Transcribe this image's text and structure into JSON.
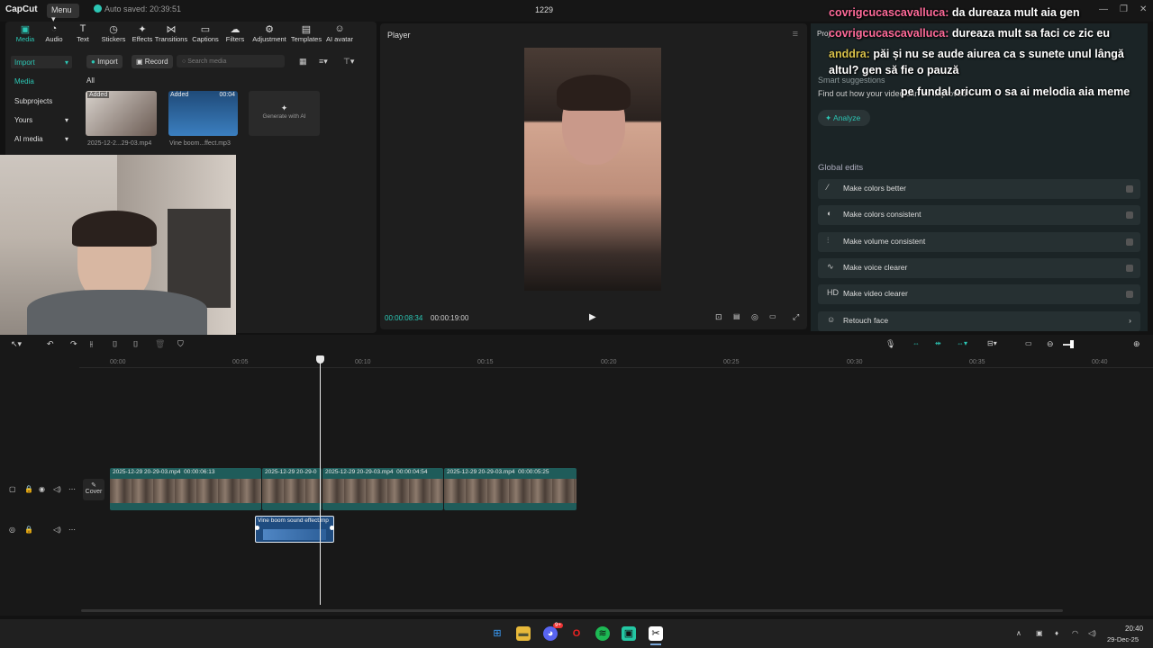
{
  "titlebar": {
    "logo": "CapCut",
    "menu": "Menu",
    "autosave": "Auto saved: 20:39:51",
    "project": "1229"
  },
  "toolbar": {
    "tools": [
      "Media",
      "Audio",
      "Text",
      "Stickers",
      "Effects",
      "Transitions",
      "Captions",
      "Filters",
      "Adjustment",
      "Templates",
      "AI avatar"
    ]
  },
  "sidenav": {
    "import": "Import",
    "media": "Media",
    "subprojects": "Subprojects",
    "yours": "Yours",
    "ai_media": "AI media"
  },
  "media": {
    "import_btn": "Import",
    "record_btn": "Record",
    "search_placeholder": "Search media",
    "filter_all": "All",
    "items": [
      {
        "badge": "Added",
        "name": "2025-12-2...29-03.mp4"
      },
      {
        "badge": "Added",
        "duration": "00:04",
        "name": "Vine boom...ffect.mp3"
      }
    ],
    "generate_ai": "Generate with AI"
  },
  "player": {
    "title": "Player",
    "current_time": "00:00:08:34",
    "total_time": "00:00:19:00"
  },
  "right_panel": {
    "tab_a": "Proj",
    "tab_b": "AI",
    "smart_suggestions": "Smart suggestions",
    "find_out": "Find out how your video can be improved",
    "analyze": "Analyze",
    "global_edits": "Global edits",
    "items": [
      "Make colors better",
      "Make colors consistent",
      "Make volume consistent",
      "Make voice clearer",
      "Make video clearer",
      "Retouch face"
    ]
  },
  "chat": [
    {
      "user": "covrigcucascavalluca:",
      "msg": " da dureaza mult aia gen"
    },
    {
      "user": "covrigcucascavalluca:",
      "msg": " dureaza mult sa faci ce zic eu"
    },
    {
      "user": "anddra:",
      "msg": " păi și nu se aude aiurea ca s sunete unul lângă"
    },
    {
      "user": "",
      "msg": "altul? gen să fie o pauză"
    },
    {
      "user": "",
      "msg": "pe fundal oricum o sa ai melodia aia meme"
    }
  ],
  "timeline": {
    "ticks": [
      "00:00",
      "00:05",
      "00:10",
      "00:15",
      "00:20",
      "00:25",
      "00:30",
      "00:35",
      "00:40"
    ],
    "cover": "Cover",
    "clips": [
      {
        "name": "2025-12-29 20-29-03.mp4",
        "duration": "00:00:06:13"
      },
      {
        "name": "2025-12-29 20-29-0",
        "duration": ""
      },
      {
        "name": "2025-12-29 20-29-03.mp4",
        "duration": "00:00:04:54"
      },
      {
        "name": "2025-12-29 20-29-03.mp4",
        "duration": "00:00:05:25"
      }
    ],
    "audio_clip": "Vine boom sound effect.mp"
  },
  "taskbar": {
    "time": "20:40",
    "date": "29-Dec-25",
    "badge": "9+"
  }
}
